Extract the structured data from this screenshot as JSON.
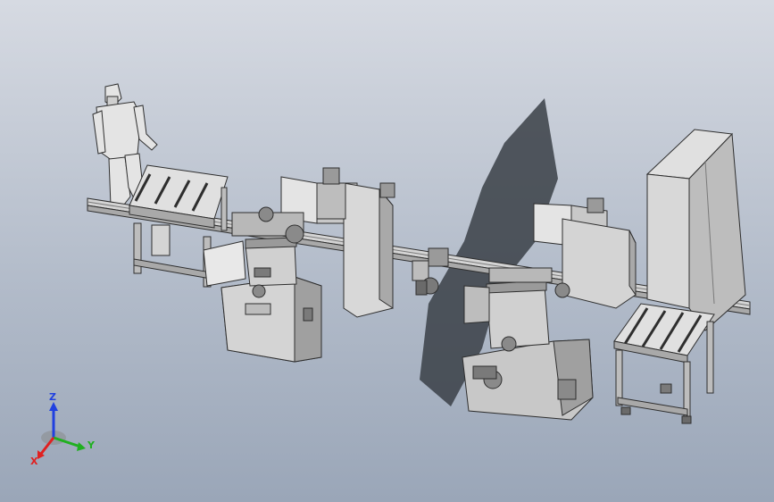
{
  "viewport": {
    "background_top": "#d6dae2",
    "background_bottom": "#9aa6b8"
  },
  "model": {
    "part_fill": "#d4d4d4",
    "part_shade": "#a9a9a9",
    "part_dark": "#7a7a7a",
    "edge_color": "#2e2e2e",
    "shadow_color": "#3a3f47"
  },
  "triad": {
    "x_label": "X",
    "y_label": "Y",
    "z_label": "Z",
    "x_color": "#e02020",
    "y_color": "#20b020",
    "z_color": "#2040e0"
  }
}
